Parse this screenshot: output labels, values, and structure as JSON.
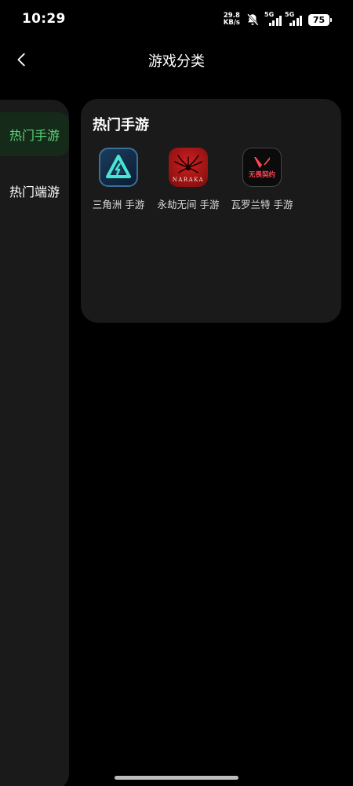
{
  "status_bar": {
    "time": "10:29",
    "net_speed_value": "29.8",
    "net_speed_unit": "KB/s",
    "signal_1_label": "5G",
    "signal_2_label": "5G",
    "battery_level": "75"
  },
  "header": {
    "back_icon": "chevron-left-icon",
    "title": "游戏分类"
  },
  "sidebar": {
    "items": [
      {
        "label": "热门手游",
        "active": true
      },
      {
        "label": "热门端游",
        "active": false
      }
    ]
  },
  "category": {
    "title": "热门手游",
    "games": [
      {
        "label": "三角洲 手游",
        "icon": "delta-force-icon"
      },
      {
        "label": "永劫无间 手游",
        "icon": "naraka-icon",
        "icon_text": "NARAKA"
      },
      {
        "label": "瓦罗兰特 手游",
        "icon": "valorant-icon",
        "icon_text": "无畏契约"
      }
    ]
  },
  "colors": {
    "background": "#000000",
    "panel": "#1a1a1a",
    "accent": "#5bd67a",
    "active_item_bg": "#152a19"
  }
}
